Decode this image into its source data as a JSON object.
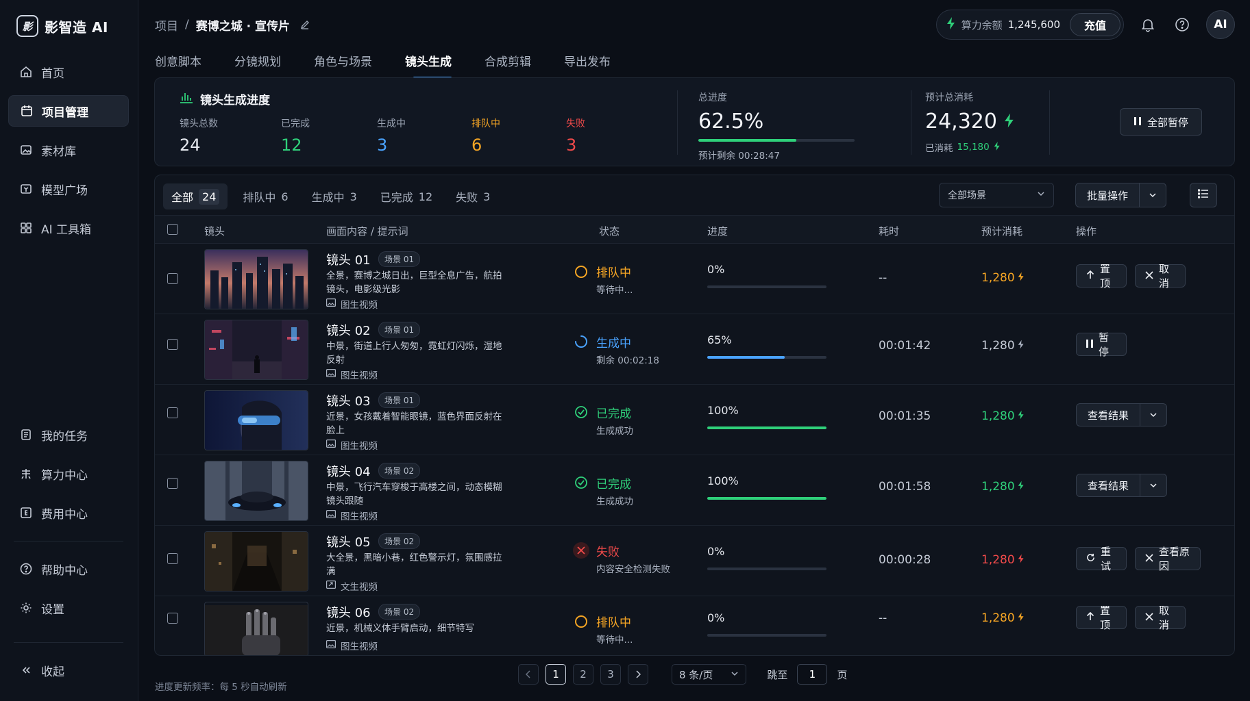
{
  "brand": {
    "logo_glyph": "影",
    "name": "影智造 AI"
  },
  "sidebar": {
    "items": [
      {
        "label": "首页",
        "icon": "home-icon"
      },
      {
        "label": "项目管理",
        "icon": "project-icon",
        "active": true
      },
      {
        "label": "素材库",
        "icon": "image-library-icon"
      },
      {
        "label": "模型广场",
        "icon": "cube-icon"
      },
      {
        "label": "AI 工具箱",
        "icon": "grid-tools-icon"
      }
    ],
    "lower_items": [
      {
        "label": "我的任务",
        "icon": "task-list-icon"
      },
      {
        "label": "算力中心",
        "icon": "compute-icon"
      },
      {
        "label": "费用中心",
        "icon": "billing-icon"
      }
    ],
    "help_items": [
      {
        "label": "帮助中心",
        "icon": "help-icon"
      },
      {
        "label": "设置",
        "icon": "settings-icon"
      }
    ],
    "collapse_label": "收起"
  },
  "breadcrumb": {
    "root": "项目",
    "separator": "/",
    "current": "赛博之城 · 宣传片"
  },
  "topbar": {
    "balance_label": "算力余额",
    "balance_value": "1,245,600",
    "recharge_label": "充值",
    "avatar_text": "AI"
  },
  "tabs": [
    "创意脚本",
    "分镜规划",
    "角色与场景",
    "镜头生成",
    "合成剪辑",
    "导出发布"
  ],
  "active_tab": 3,
  "progress": {
    "title": "镜头生成进度",
    "stats": [
      {
        "label": "镜头总数",
        "value": "24",
        "color": "#e6e9ef"
      },
      {
        "label": "已完成",
        "value": "12",
        "color": "#2fd07a"
      },
      {
        "label": "生成中",
        "value": "3",
        "color": "#4aa3ff"
      },
      {
        "label": "排队中",
        "value": "6",
        "color": "#f5a524"
      },
      {
        "label": "失败",
        "value": "3",
        "color": "#f04a4a"
      }
    ],
    "total_label": "总进度",
    "total_value": "62.5%",
    "total_fraction": 0.625,
    "remaining": "预计剩余 00:28:47",
    "cost_label": "预计总消耗",
    "cost_value": "24,320",
    "consumed_label": "已消耗",
    "consumed_value": "15,180",
    "pause_all_label": "全部暂停"
  },
  "filters": {
    "tabs": [
      {
        "label": "全部",
        "count": "24"
      },
      {
        "label": "排队中",
        "count": "6"
      },
      {
        "label": "生成中",
        "count": "3"
      },
      {
        "label": "已完成",
        "count": "12"
      },
      {
        "label": "失败",
        "count": "3"
      }
    ],
    "scene_select": "全部场景",
    "batch_label": "批量操作"
  },
  "columns": [
    "镜头",
    "画面内容 / 提示词",
    "状态",
    "进度",
    "耗时",
    "预计消耗",
    "操作"
  ],
  "rows": [
    {
      "name": "镜头 01",
      "scene": "场景 01",
      "desc": "全景，赛博之城日出，巨型全息广告，航拍镜头，电影级光影",
      "kind": "图生视频",
      "status": "排队中",
      "status_sub": "等待中...",
      "status_key": "queued",
      "progress_text": "0%",
      "progress": 0,
      "time": "--",
      "cost": "1,280",
      "actions": [
        "置顶",
        "取消"
      ]
    },
    {
      "name": "镜头 02",
      "scene": "场景 01",
      "desc": "中景，街道上行人匆匆，霓虹灯闪烁，湿地反射",
      "kind": "图生视频",
      "status": "生成中",
      "status_sub": "剩余 00:02:18",
      "status_key": "running",
      "progress_text": "65%",
      "progress": 0.65,
      "time": "00:01:42",
      "cost": "1,280",
      "actions": [
        "暂停"
      ]
    },
    {
      "name": "镜头 03",
      "scene": "场景 01",
      "desc": "近景，女孩戴着智能眼镜，蓝色界面反射在脸上",
      "kind": "图生视频",
      "status": "已完成",
      "status_sub": "生成成功",
      "status_key": "done",
      "progress_text": "100%",
      "progress": 1,
      "time": "00:01:35",
      "cost": "1,280",
      "actions": [
        "查看结果"
      ]
    },
    {
      "name": "镜头 04",
      "scene": "场景 02",
      "desc": "中景，飞行汽车穿梭于高楼之间，动态模糊镜头跟随",
      "kind": "图生视频",
      "status": "已完成",
      "status_sub": "生成成功",
      "status_key": "done",
      "progress_text": "100%",
      "progress": 1,
      "time": "00:01:58",
      "cost": "1,280",
      "actions": [
        "查看结果"
      ]
    },
    {
      "name": "镜头 05",
      "scene": "场景 02",
      "desc": "大全景，黑暗小巷，红色警示灯，氛围感拉满",
      "kind": "文生视频",
      "status": "失败",
      "status_sub": "内容安全检测失败",
      "status_key": "failed",
      "progress_text": "0%",
      "progress": 0,
      "time": "00:00:28",
      "cost": "1,280",
      "actions": [
        "重试",
        "查看原因"
      ]
    },
    {
      "name": "镜头 06",
      "scene": "场景 02",
      "desc": "近景，机械义体手臂启动，细节特写",
      "kind": "图生视频",
      "status": "排队中",
      "status_sub": "等待中...",
      "status_key": "queued",
      "progress_text": "0%",
      "progress": 0,
      "time": "--",
      "cost": "1,280",
      "actions": [
        "置顶",
        "取消"
      ]
    }
  ],
  "footer": {
    "note": "进度更新频率：每 5 秒自动刷新",
    "pages": [
      "1",
      "2",
      "3"
    ],
    "current_page": "1",
    "page_size": "8 条/页",
    "jump_label": "跳至",
    "jump_value": "1",
    "page_unit": "页"
  },
  "colors": {
    "queued": "#f5a524",
    "running": "#4aa3ff",
    "done": "#2fd07a",
    "failed": "#f04a4a",
    "accent": "#4aa3ff"
  }
}
